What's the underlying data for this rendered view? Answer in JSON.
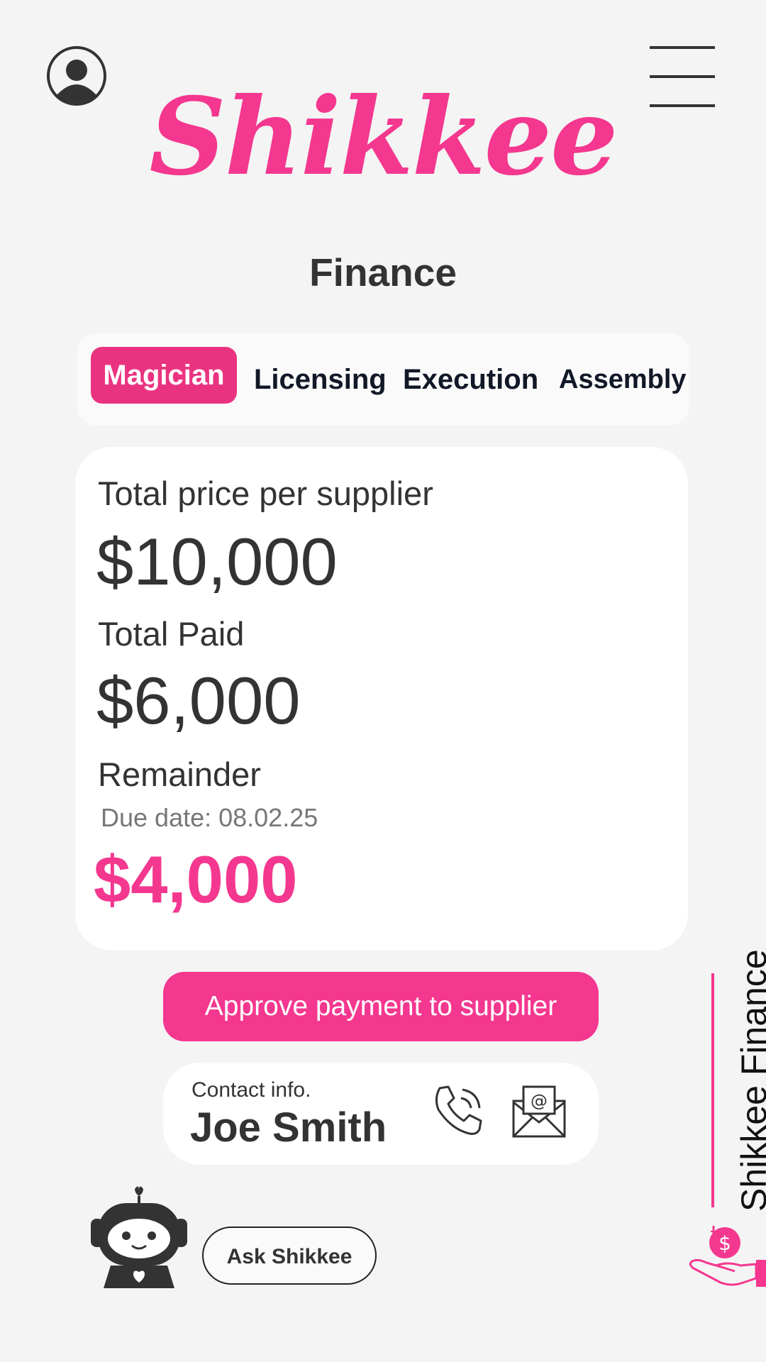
{
  "header": {
    "logo_text": "Shikkee",
    "profile_icon": "user-circle-icon",
    "menu_icon": "hamburger-menu-icon"
  },
  "page": {
    "title": "Finance"
  },
  "tabs": [
    {
      "label": "Magician",
      "active": true
    },
    {
      "label": "Licensing",
      "active": false
    },
    {
      "label": "Execution",
      "active": false
    },
    {
      "label": "Assembly",
      "active": false
    }
  ],
  "summary": {
    "total_price_label": "Total price per supplier",
    "total_price_value": "$10,000",
    "total_paid_label": "Total Paid",
    "total_paid_value": "$6,000",
    "remainder_label": "Remainder",
    "due_date": "Due date: 08.02.25",
    "remainder_value": "$4,000"
  },
  "approve_button": {
    "label": "Approve payment to supplier"
  },
  "contact": {
    "label": "Contact info.",
    "name": "Joe Smith",
    "phone_icon": "phone-icon",
    "email_icon": "email-icon"
  },
  "assistant": {
    "button_label": "Ask Shikkee",
    "icon": "robot-icon"
  },
  "side_brand": {
    "text": "Shikkee Finance",
    "icon": "hand-dollar-icon"
  },
  "colors": {
    "accent": "#f4378f",
    "tab_active": "#ea3380",
    "background": "#f4f4f4",
    "text": "#333333"
  }
}
